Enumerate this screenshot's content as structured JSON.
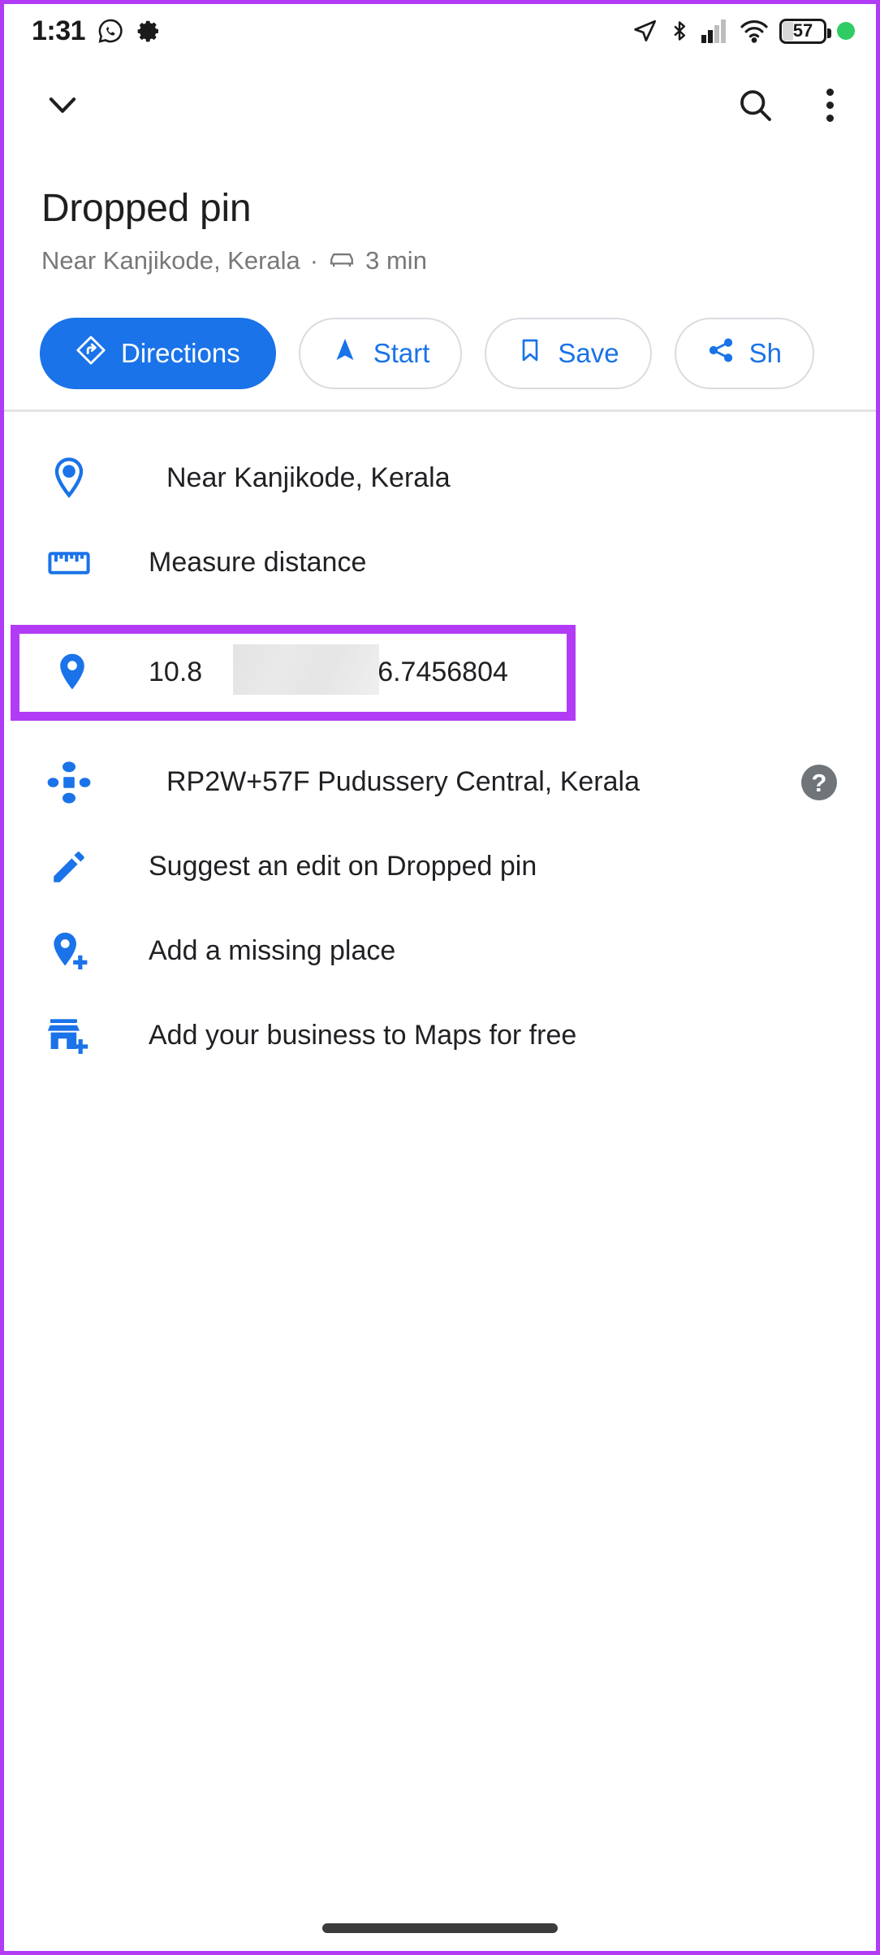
{
  "status_bar": {
    "time": "1:31",
    "left_icons": [
      "whatsapp-icon",
      "gear-icon"
    ],
    "right_icons": [
      "location-arrow-icon",
      "bluetooth-icon",
      "cellular-signal-icon",
      "wifi-icon"
    ],
    "battery_percent": "57",
    "recording_dot": "green-dot"
  },
  "header": {
    "collapse_icon": "chevron-down-icon",
    "search_icon": "search-icon",
    "overflow_icon": "three-dot-menu-icon"
  },
  "place": {
    "title": "Dropped pin",
    "subtitle_location": "Near Kanjikode, Kerala",
    "subtitle_separator": "·",
    "drive_icon": "car-icon",
    "drive_time": "3 min"
  },
  "actions": [
    {
      "label": "Directions",
      "icon": "directions-diamond-icon",
      "primary": true
    },
    {
      "label": "Start",
      "icon": "navigation-arrow-icon",
      "primary": false
    },
    {
      "label": "Save",
      "icon": "bookmark-icon",
      "primary": false
    },
    {
      "label": "Sh",
      "icon": "share-icon",
      "primary": false
    }
  ],
  "rows": {
    "address": {
      "label": "Near Kanjikode, Kerala",
      "icon": "location-pin-outline-icon"
    },
    "measure": {
      "label": "Measure distance",
      "icon": "ruler-icon"
    },
    "coordinates": {
      "icon": "location-pin-filled-icon",
      "latitude_visible": "10.8",
      "longitude_visible": "6.7456804",
      "redacted": true,
      "highlighted": true,
      "highlight_color": "#b23cf5"
    },
    "plus_code": {
      "label": "RP2W+57F Pudussery Central, Kerala",
      "icon": "plus-code-icon",
      "help_icon": "help-question-icon",
      "help_label": "?"
    },
    "suggest_edit": {
      "label": "Suggest an edit on Dropped pin",
      "icon": "pencil-icon"
    },
    "add_place": {
      "label": "Add a missing place",
      "icon": "add-pin-icon"
    },
    "add_business": {
      "label": "Add your business to Maps for free",
      "icon": "add-storefront-icon"
    }
  },
  "theme": {
    "accent_blue": "#1a73e8",
    "text_primary": "#202124",
    "text_secondary": "#787878",
    "highlight_purple": "#b23cf5"
  }
}
